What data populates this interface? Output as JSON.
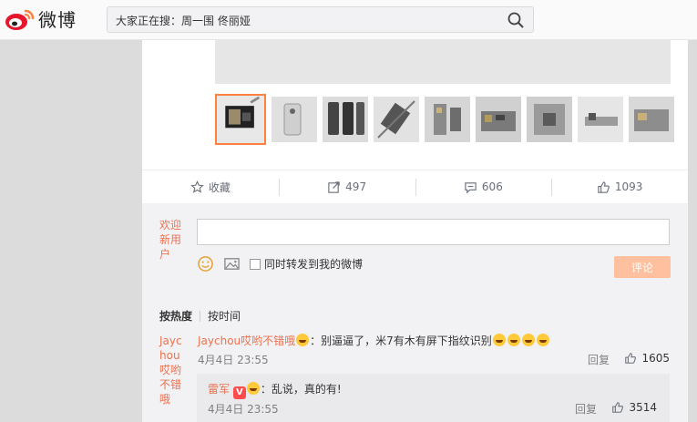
{
  "brand": {
    "name": "微博",
    "accent": "#ff8140"
  },
  "search": {
    "label": "大家正在搜：周一围 佟丽娅"
  },
  "actions": {
    "favorite_label": "收藏",
    "repost_count": "497",
    "comment_count": "606",
    "like_count": "1093"
  },
  "compose": {
    "welcome": [
      "欢迎",
      "新用",
      "户"
    ],
    "share_label": "同时转发到我的微博",
    "submit_label": "评论"
  },
  "sort": {
    "hot_label": "按热度",
    "time_label": "按时间"
  },
  "comment": {
    "author_display": "Jaychou哎哟不错哦",
    "author_name": "Jaychou哎哟不错哦",
    "text_before": "：别逼逼了，米7有木有屏下指纹识别",
    "date": "4月4日 23:55",
    "reply_label": "回复",
    "likes": "1605"
  },
  "subcomment": {
    "author_name": "雷军",
    "verified_badge": "V",
    "text": "：乱说，真的有!",
    "date": "4月4日 23:55",
    "reply_label": "回复",
    "likes": "3514"
  },
  "icons": {
    "logo": "weibo-logo-icon",
    "search": "search-icon",
    "favorite": "star-icon",
    "repost": "repost-icon",
    "comment": "comment-icon",
    "like": "thumbs-up-icon",
    "emoji": "emoji-icon",
    "image": "image-icon"
  }
}
